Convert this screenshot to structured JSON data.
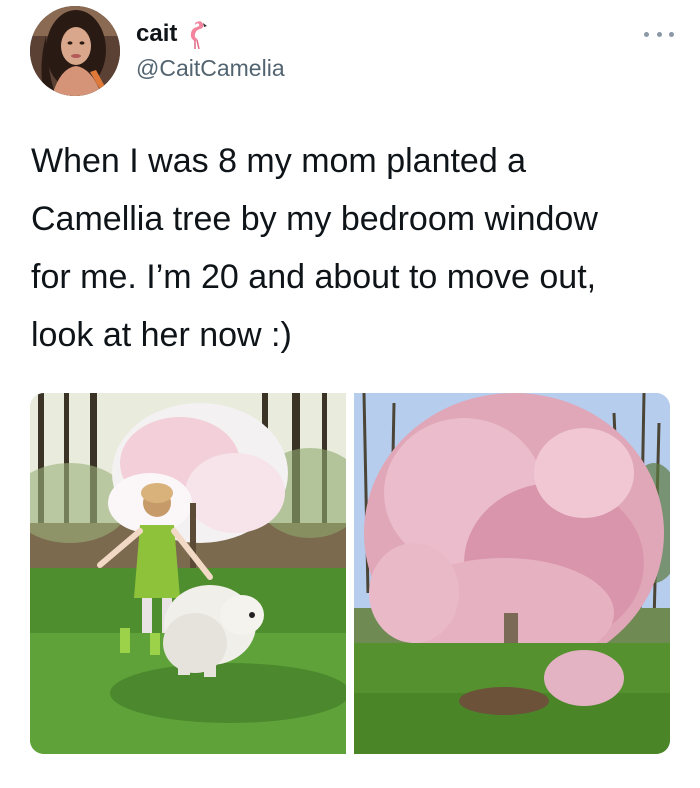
{
  "author": {
    "display_name": "cait",
    "name_emoji": "flamingo-icon",
    "handle": "@CaitCamelia"
  },
  "tweet": {
    "text": "When I was 8 my mom planted a\nCamellia tree by my bedroom window\nfor me. I’m 20 and about to move out,\nlook at her now :)"
  },
  "media": [
    {
      "subject": "girl-with-dog-under-young-tree-photo"
    },
    {
      "subject": "grown-blossoming-tree-photo"
    }
  ],
  "colors": {
    "text": "#0f1419",
    "secondary": "#536471",
    "blossom": "#e8b4c4",
    "grass": "#4f8e2e"
  }
}
